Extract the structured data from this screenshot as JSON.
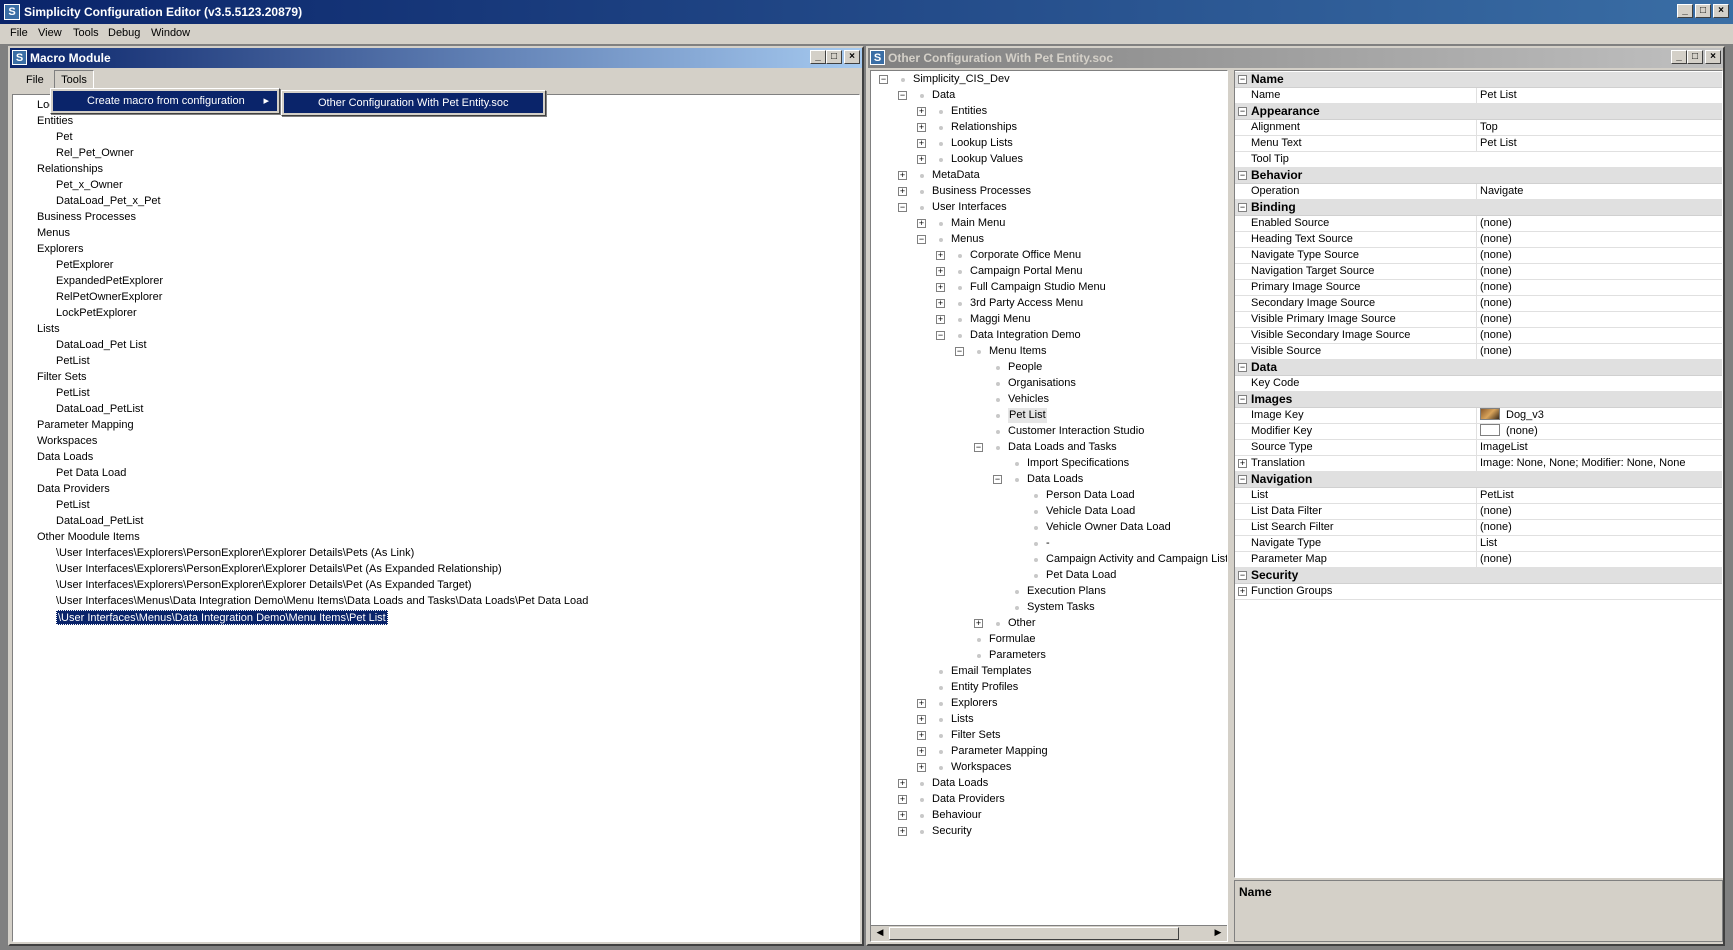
{
  "app": {
    "title": "Simplicity Configuration Editor (v3.5.5123.20879)",
    "menu": [
      "File",
      "View",
      "Tools",
      "Debug",
      "Window"
    ]
  },
  "macro_window": {
    "title": "Macro Module",
    "menu": [
      "File",
      "Tools"
    ],
    "tools_menu": {
      "item": "Create macro from configuration",
      "submenu_item": "Other Configuration With Pet Entity.soc"
    },
    "tree": [
      {
        "text": "Look",
        "level": 0
      },
      {
        "text": "Entities",
        "level": 0
      },
      {
        "text": "Pet",
        "level": 1
      },
      {
        "text": "Rel_Pet_Owner",
        "level": 1
      },
      {
        "text": "Relationships",
        "level": 0
      },
      {
        "text": "Pet_x_Owner",
        "level": 1
      },
      {
        "text": "DataLoad_Pet_x_Pet",
        "level": 1
      },
      {
        "text": "Business Processes",
        "level": 0
      },
      {
        "text": "Menus",
        "level": 0
      },
      {
        "text": "Explorers",
        "level": 0
      },
      {
        "text": "PetExplorer",
        "level": 1
      },
      {
        "text": "ExpandedPetExplorer",
        "level": 1
      },
      {
        "text": "RelPetOwnerExplorer",
        "level": 1
      },
      {
        "text": "LockPetExplorer",
        "level": 1
      },
      {
        "text": "Lists",
        "level": 0
      },
      {
        "text": "DataLoad_Pet List",
        "level": 1
      },
      {
        "text": "PetList",
        "level": 1
      },
      {
        "text": "Filter Sets",
        "level": 0
      },
      {
        "text": "PetList",
        "level": 1
      },
      {
        "text": "DataLoad_PetList",
        "level": 1
      },
      {
        "text": "Parameter Mapping",
        "level": 0
      },
      {
        "text": "Workspaces",
        "level": 0
      },
      {
        "text": "Data Loads",
        "level": 0
      },
      {
        "text": "Pet Data Load",
        "level": 1
      },
      {
        "text": "Data Providers",
        "level": 0
      },
      {
        "text": "PetList",
        "level": 1
      },
      {
        "text": "DataLoad_PetList",
        "level": 1
      },
      {
        "text": "Other Moodule Items",
        "level": 0
      },
      {
        "text": "\\User Interfaces\\Explorers\\PersonExplorer\\Explorer Details\\Pets (As Link)",
        "level": 1
      },
      {
        "text": "\\User Interfaces\\Explorers\\PersonExplorer\\Explorer Details\\Pet (As Expanded Relationship)",
        "level": 1
      },
      {
        "text": "\\User Interfaces\\Explorers\\PersonExplorer\\Explorer Details\\Pet (As Expanded Target)",
        "level": 1
      },
      {
        "text": "\\User Interfaces\\Menus\\Data Integration Demo\\Menu Items\\Data Loads and Tasks\\Data Loads\\Pet Data Load",
        "level": 1
      },
      {
        "text": "\\User Interfaces\\Menus\\Data Integration Demo\\Menu Items\\Pet List",
        "level": 1,
        "selected": true
      }
    ]
  },
  "config_window": {
    "title": "Other Configuration With Pet Entity.soc",
    "tree": [
      {
        "text": "Simplicity_CIS_Dev",
        "level": 0,
        "exp": "-"
      },
      {
        "text": "Data",
        "level": 1,
        "exp": "-"
      },
      {
        "text": "Entities",
        "level": 2,
        "exp": "+"
      },
      {
        "text": "Relationships",
        "level": 2,
        "exp": "+"
      },
      {
        "text": "Lookup Lists",
        "level": 2,
        "exp": "+"
      },
      {
        "text": "Lookup Values",
        "level": 2,
        "exp": "+"
      },
      {
        "text": "MetaData",
        "level": 1,
        "exp": "+"
      },
      {
        "text": "Business Processes",
        "level": 1,
        "exp": "+"
      },
      {
        "text": "User Interfaces",
        "level": 1,
        "exp": "-"
      },
      {
        "text": "Main Menu",
        "level": 2,
        "exp": "+"
      },
      {
        "text": "Menus",
        "level": 2,
        "exp": "-"
      },
      {
        "text": "Corporate Office Menu",
        "level": 3,
        "exp": "+"
      },
      {
        "text": "Campaign Portal Menu",
        "level": 3,
        "exp": "+"
      },
      {
        "text": "Full Campaign Studio Menu",
        "level": 3,
        "exp": "+"
      },
      {
        "text": "3rd Party Access Menu",
        "level": 3,
        "exp": "+"
      },
      {
        "text": "Maggi Menu",
        "level": 3,
        "exp": "+"
      },
      {
        "text": "Data Integration Demo",
        "level": 3,
        "exp": "-"
      },
      {
        "text": "Menu Items",
        "level": 4,
        "exp": "-"
      },
      {
        "text": "People",
        "level": 5,
        "exp": ""
      },
      {
        "text": "Organisations",
        "level": 5,
        "exp": ""
      },
      {
        "text": "Vehicles",
        "level": 5,
        "exp": ""
      },
      {
        "text": "Pet List",
        "level": 5,
        "exp": "",
        "highlight": true
      },
      {
        "text": "Customer Interaction Studio",
        "level": 5,
        "exp": ""
      },
      {
        "text": "Data Loads and Tasks",
        "level": 5,
        "exp": "-"
      },
      {
        "text": "Import Specifications",
        "level": 6,
        "exp": ""
      },
      {
        "text": "Data Loads",
        "level": 6,
        "exp": "-"
      },
      {
        "text": "Person Data Load",
        "level": 7,
        "exp": ""
      },
      {
        "text": "Vehicle Data Load",
        "level": 7,
        "exp": ""
      },
      {
        "text": "Vehicle Owner Data Load",
        "level": 7,
        "exp": ""
      },
      {
        "text": "-",
        "level": 7,
        "exp": ""
      },
      {
        "text": "Campaign Activity and Campaign List Data Load",
        "level": 7,
        "exp": ""
      },
      {
        "text": "Pet Data Load",
        "level": 7,
        "exp": ""
      },
      {
        "text": "Execution Plans",
        "level": 6,
        "exp": ""
      },
      {
        "text": "System Tasks",
        "level": 6,
        "exp": ""
      },
      {
        "text": "Other",
        "level": 5,
        "exp": "+"
      },
      {
        "text": "Formulae",
        "level": 4,
        "exp": ""
      },
      {
        "text": "Parameters",
        "level": 4,
        "exp": ""
      },
      {
        "text": "Email Templates",
        "level": 2,
        "exp": ""
      },
      {
        "text": "Entity Profiles",
        "level": 2,
        "exp": ""
      },
      {
        "text": "Explorers",
        "level": 2,
        "exp": "+"
      },
      {
        "text": "Lists",
        "level": 2,
        "exp": "+"
      },
      {
        "text": "Filter Sets",
        "level": 2,
        "exp": "+"
      },
      {
        "text": "Parameter Mapping",
        "level": 2,
        "exp": "+"
      },
      {
        "text": "Workspaces",
        "level": 2,
        "exp": "+"
      },
      {
        "text": "Data Loads",
        "level": 1,
        "exp": "+"
      },
      {
        "text": "Data Providers",
        "level": 1,
        "exp": "+"
      },
      {
        "text": "Behaviour",
        "level": 1,
        "exp": "+"
      },
      {
        "text": "Security",
        "level": 1,
        "exp": "+"
      }
    ],
    "properties": [
      {
        "cat": "Name"
      },
      {
        "name": "Name",
        "value": "Pet List"
      },
      {
        "cat": "Appearance"
      },
      {
        "name": "Alignment",
        "value": "Top"
      },
      {
        "name": "Menu Text",
        "value": "Pet List"
      },
      {
        "name": "Tool Tip",
        "value": ""
      },
      {
        "cat": "Behavior"
      },
      {
        "name": "Operation",
        "value": "Navigate"
      },
      {
        "cat": "Binding"
      },
      {
        "name": "Enabled Source",
        "value": "(none)"
      },
      {
        "name": "Heading Text Source",
        "value": "(none)"
      },
      {
        "name": "Navigate Type Source",
        "value": "(none)"
      },
      {
        "name": "Navigation Target Source",
        "value": "(none)"
      },
      {
        "name": "Primary Image Source",
        "value": "(none)"
      },
      {
        "name": "Secondary Image Source",
        "value": "(none)"
      },
      {
        "name": "Visible Primary Image Source",
        "value": "(none)"
      },
      {
        "name": "Visible Secondary Image Source",
        "value": "(none)"
      },
      {
        "name": "Visible Source",
        "value": "(none)"
      },
      {
        "cat": "Data"
      },
      {
        "name": "Key Code",
        "value": ""
      },
      {
        "cat": "Images"
      },
      {
        "name": "Image Key",
        "value": "Dog_v3",
        "swatch": "image"
      },
      {
        "name": "Modifier Key",
        "value": "(none)",
        "swatch": "blank"
      },
      {
        "name": "Source Type",
        "value": "ImageList"
      },
      {
        "name": "Translation",
        "value": "Image: None, None; Modifier: None, None",
        "expand": true
      },
      {
        "cat": "Navigation"
      },
      {
        "name": "List",
        "value": "PetList"
      },
      {
        "name": "List Data Filter",
        "value": "(none)"
      },
      {
        "name": "List Search Filter",
        "value": "(none)"
      },
      {
        "name": "Navigate Type",
        "value": "List"
      },
      {
        "name": "Parameter Map",
        "value": "(none)"
      },
      {
        "cat": "Security"
      },
      {
        "name": "Function Groups",
        "value": "",
        "expand": true
      }
    ],
    "description_title": "Name"
  }
}
